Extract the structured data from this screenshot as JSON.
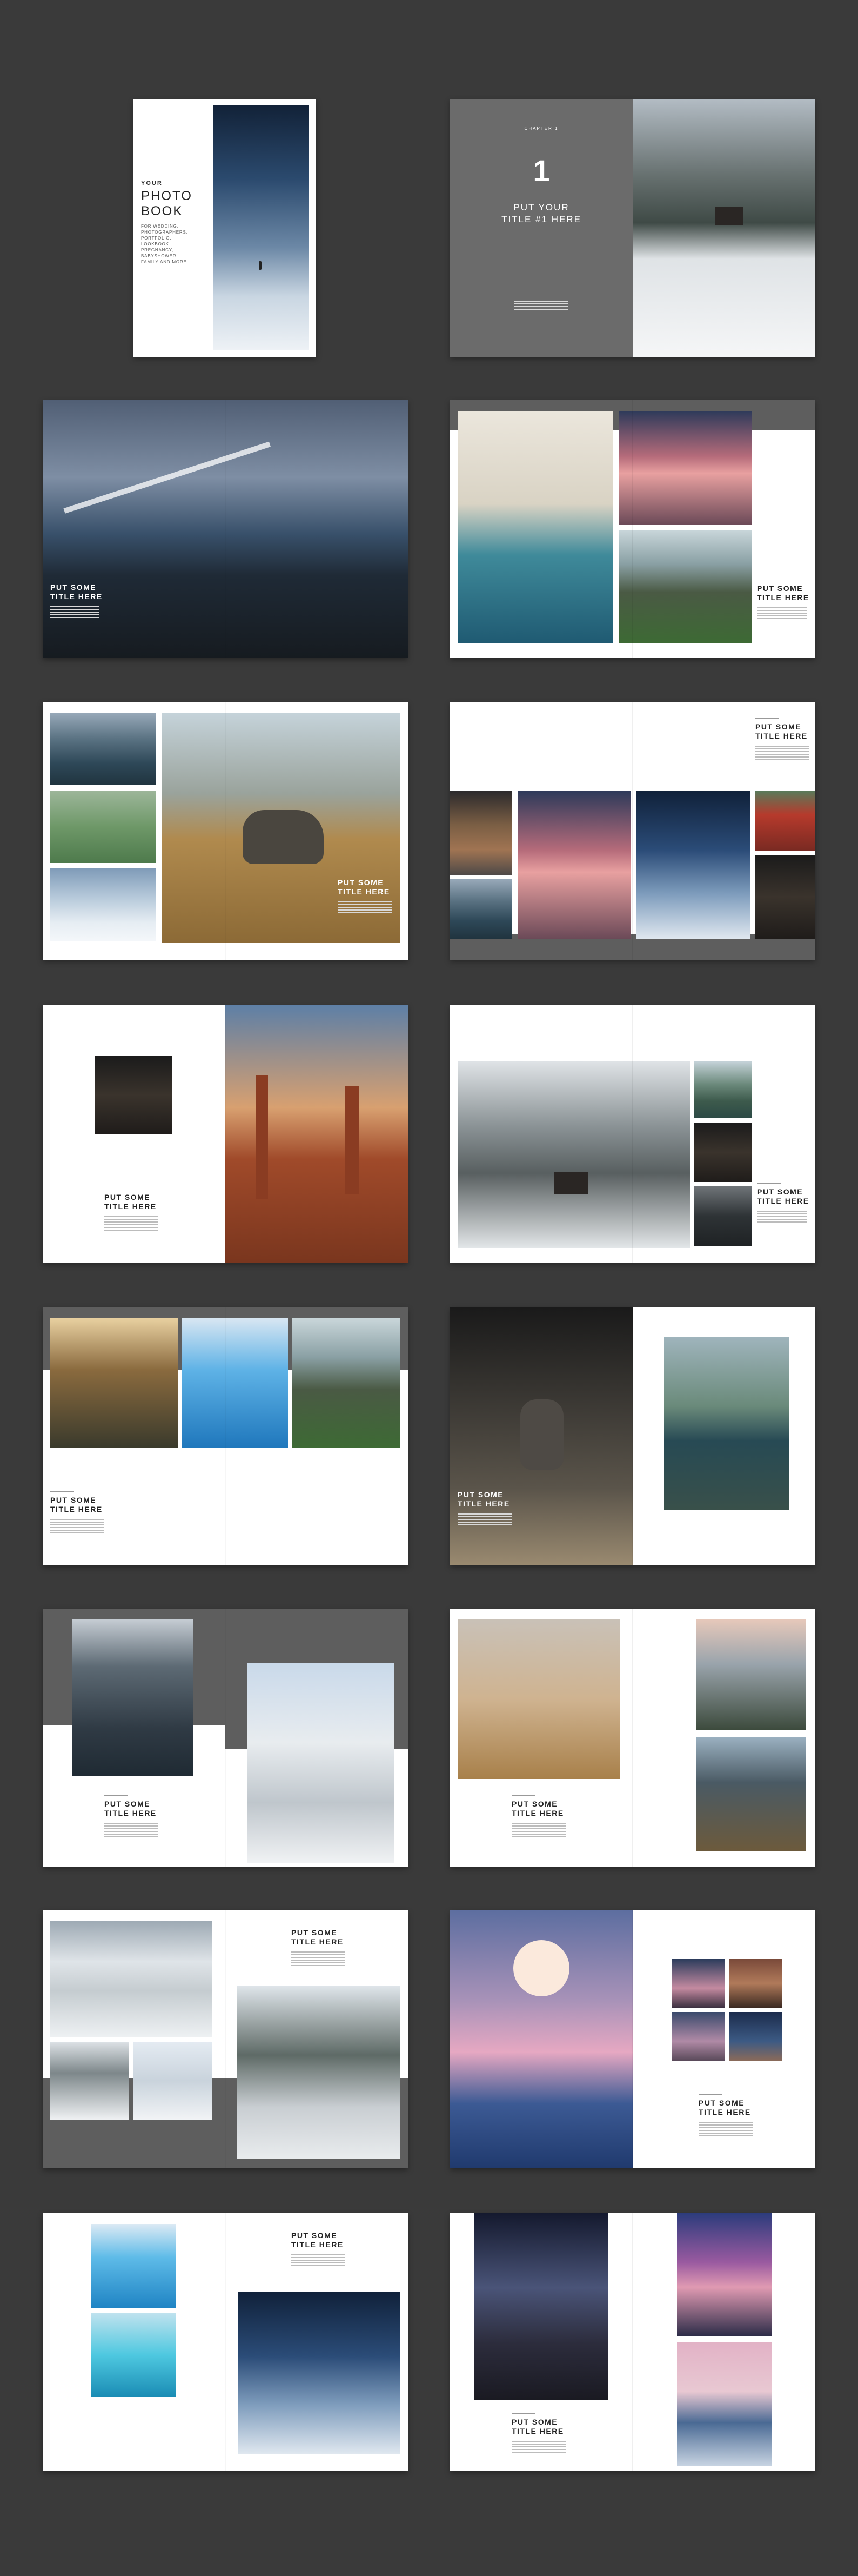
{
  "cover": {
    "line1": "YOUR",
    "line2": "PHOTO",
    "line3": "BOOK",
    "subtitle": "FOR WEDDING,\nPHOTOGRAPHERS,\nPORTFOLIO,\nLOOKBOOK\nPREGNANCY,\nBABYSHOWER,\nFAMILY AND MORE"
  },
  "chapter": {
    "label": "CHAPTER 1",
    "number": "1",
    "title": "PUT YOUR\nTITLE #1 HERE"
  },
  "section_title": "PUT SOME\nTITLE HERE"
}
